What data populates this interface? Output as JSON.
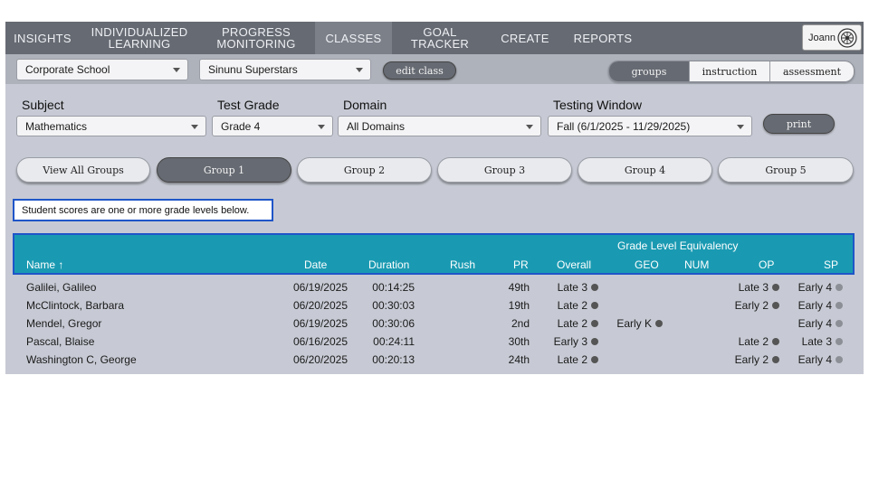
{
  "nav": {
    "items": [
      {
        "label": "INSIGHTS"
      },
      {
        "label": "INDIVIDUALIZED\nLEARNING"
      },
      {
        "label": "PROGRESS\nMONITORING"
      },
      {
        "label": "CLASSES"
      },
      {
        "label": "GOAL TRACKER"
      },
      {
        "label": "CREATE"
      },
      {
        "label": "REPORTS"
      }
    ],
    "active": "CLASSES",
    "user": "Joann",
    "user_icon": "globe-seal-icon"
  },
  "toolbar": {
    "school": "Corporate School",
    "class": "Sinunu Superstars",
    "edit_class": "edit class",
    "view_tabs": [
      "groups",
      "instruction",
      "assessment"
    ],
    "active_view": "groups"
  },
  "filters": {
    "subject_label": "Subject",
    "subject_value": "Mathematics",
    "grade_label": "Test Grade",
    "grade_value": "Grade 4",
    "domain_label": "Domain",
    "domain_value": "All Domains",
    "window_label": "Testing Window",
    "window_value": "Fall (6/1/2025 - 11/29/2025)",
    "print": "print"
  },
  "groups": {
    "tabs": [
      "View All Groups",
      "Group 1",
      "Group 2",
      "Group 3",
      "Group 4",
      "Group 5"
    ],
    "active": "Group 1"
  },
  "notice": "Student scores are one or more grade levels below.",
  "table": {
    "group_header": "Grade Level Equivalency",
    "columns": {
      "name": "Name ↑",
      "date": "Date",
      "duration": "Duration",
      "rush": "Rush",
      "pr": "PR",
      "overall": "Overall",
      "geo": "GEO",
      "num": "NUM",
      "op": "OP",
      "sp": "SP"
    },
    "rows": [
      {
        "name": "Galilei, Galileo",
        "date": "06/19/2025",
        "duration": "00:14:25",
        "rush": "",
        "pr": "49th",
        "overall": "Late 3",
        "geo": "",
        "num": "",
        "op": "Late 3",
        "sp": "Early 4"
      },
      {
        "name": "McClintock, Barbara",
        "date": "06/20/2025",
        "duration": "00:30:03",
        "rush": "",
        "pr": "19th",
        "overall": "Late 2",
        "geo": "",
        "num": "",
        "op": "Early 2",
        "sp": "Early 4"
      },
      {
        "name": "Mendel, Gregor",
        "date": "06/19/2025",
        "duration": "00:30:06",
        "rush": "",
        "pr": "2nd",
        "overall": "Late 2",
        "geo": "Early K",
        "num": "",
        "op": "",
        "sp": "Early 4"
      },
      {
        "name": "Pascal, Blaise",
        "date": "06/16/2025",
        "duration": "00:24:11",
        "rush": "",
        "pr": "30th",
        "overall": "Early 3",
        "geo": "",
        "num": "",
        "op": "Late 2",
        "sp": "Late 3"
      },
      {
        "name": "Washington C, George",
        "date": "06/20/2025",
        "duration": "00:20:13",
        "rush": "",
        "pr": "24th",
        "overall": "Late 2",
        "geo": "",
        "num": "",
        "op": "Early 2",
        "sp": "Early 4"
      }
    ],
    "dot_colors": {
      "dark": "#555555",
      "light": "#8d8f96"
    },
    "header_color": "#1a9ab2"
  }
}
